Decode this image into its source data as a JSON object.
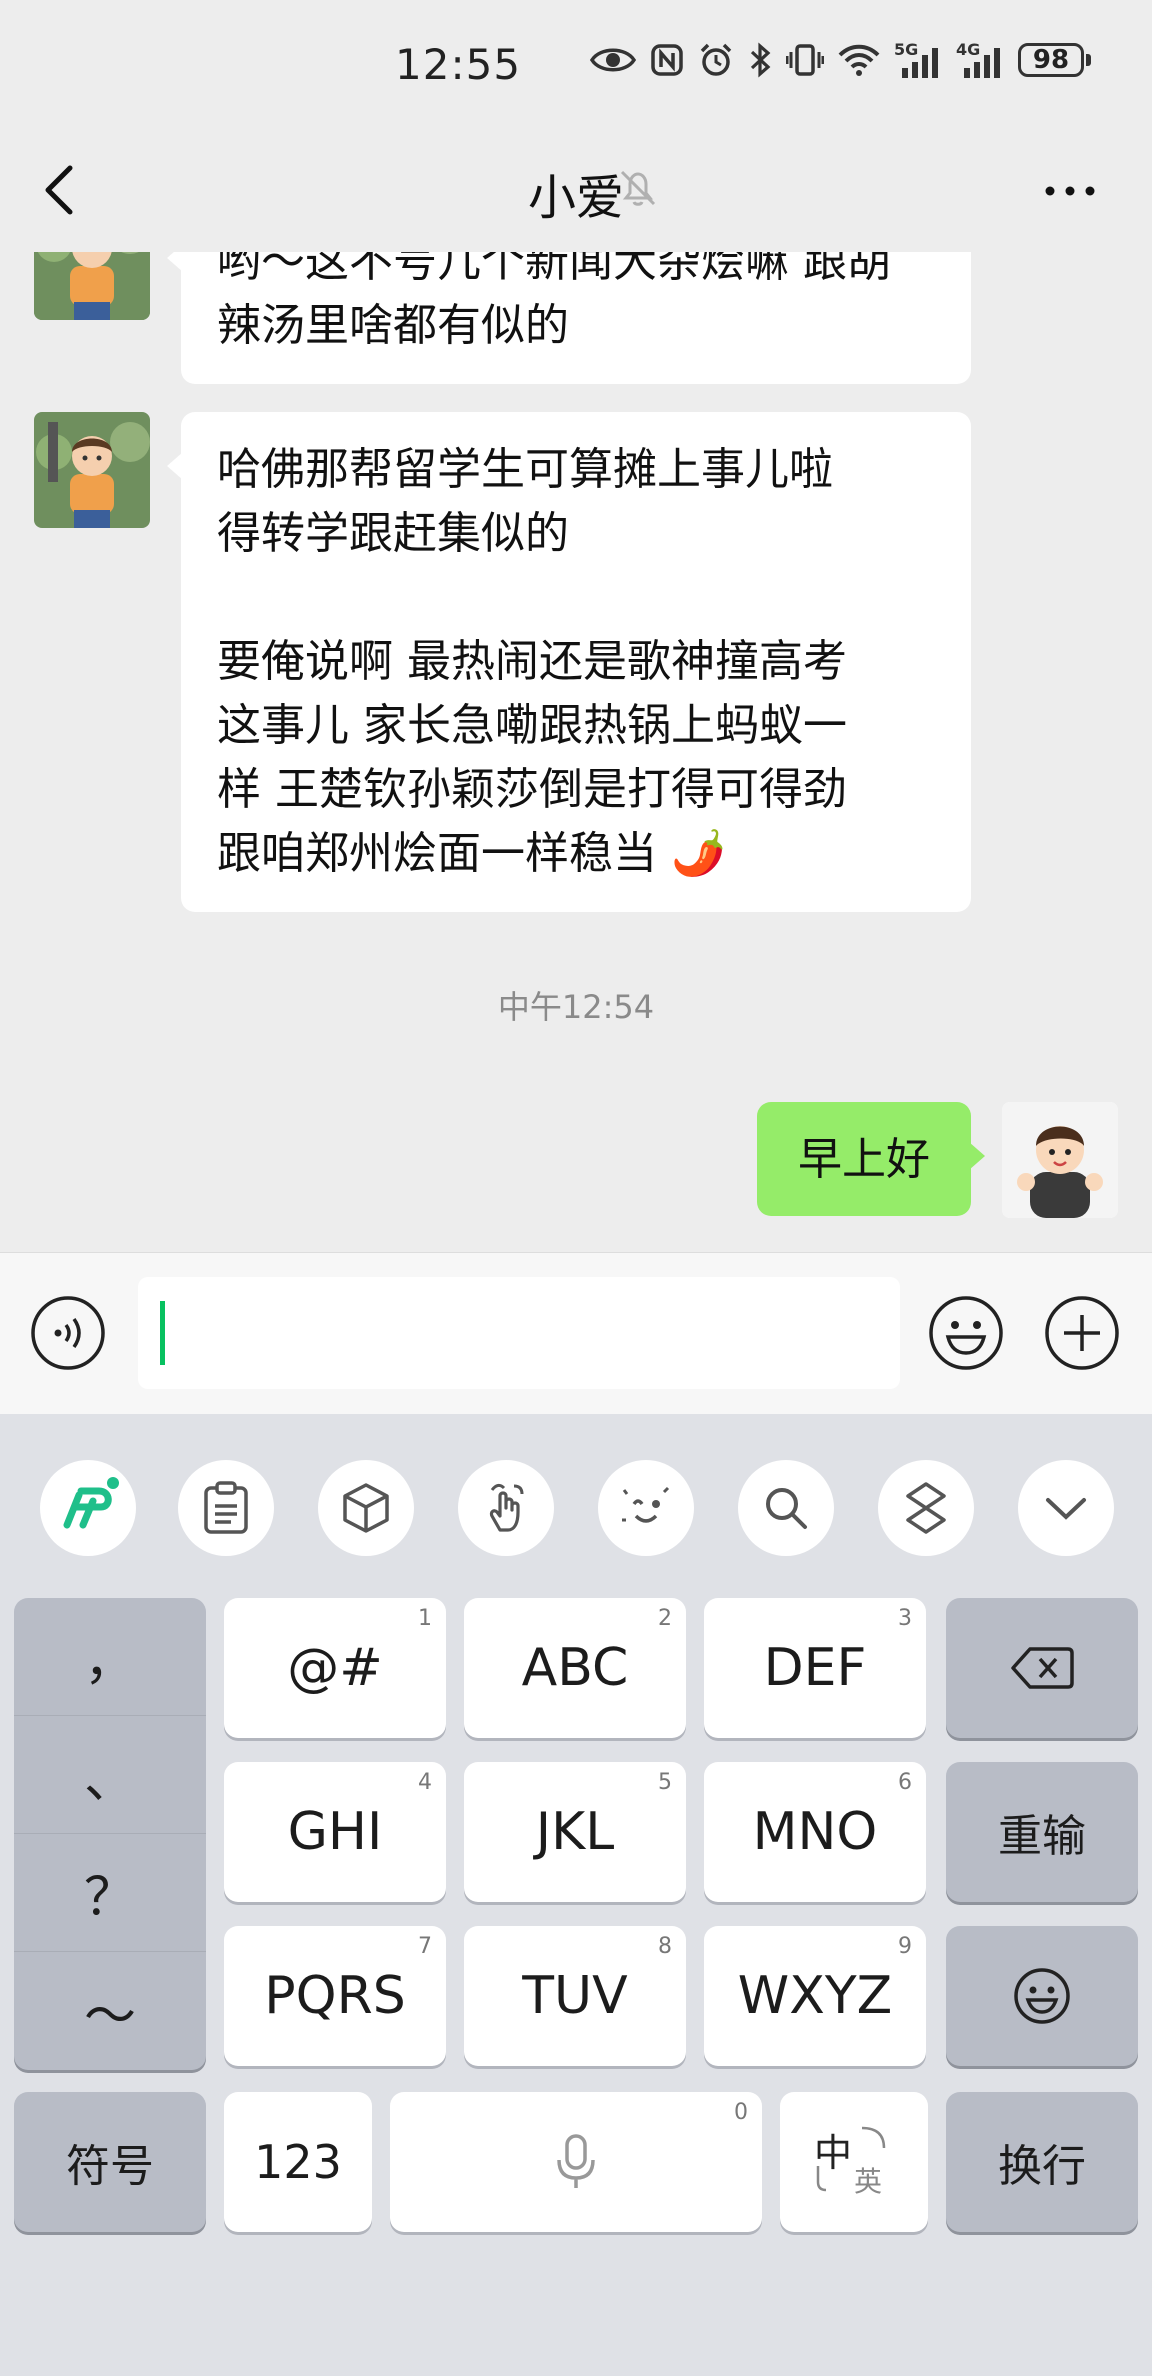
{
  "status_bar": {
    "time": "12:55",
    "battery": "98",
    "net1": "5G",
    "net2": "4G"
  },
  "header": {
    "title": "小爱"
  },
  "messages": [
    {
      "side": "in",
      "text": "哟～这不号几个新闻大杂烩嘛 跟胡\n辣汤里啥都有似的"
    },
    {
      "side": "in",
      "text": "哈佛那帮留学生可算摊上事儿啦\n得转学跟赶集似的\n\n要俺说啊 最热闹还是歌神撞高考\n这事儿 家长急嘞跟热锅上蚂蚁一\n样 王楚钦孙颖莎倒是打得可得劲\n跟咱郑州烩面一样稳当 🌶️"
    },
    {
      "side": "out",
      "text": "早上好"
    }
  ],
  "timestamp": "中午12:54",
  "keyboard": {
    "punctuation": [
      "，",
      "、",
      "？",
      "～"
    ],
    "rows": [
      [
        {
          "label": "@#",
          "num": "1"
        },
        {
          "label": "ABC",
          "num": "2"
        },
        {
          "label": "DEF",
          "num": "3"
        }
      ],
      [
        {
          "label": "GHI",
          "num": "4"
        },
        {
          "label": "JKL",
          "num": "5"
        },
        {
          "label": "MNO",
          "num": "6"
        }
      ],
      [
        {
          "label": "PQRS",
          "num": "7"
        },
        {
          "label": "TUV",
          "num": "8"
        },
        {
          "label": "WXYZ",
          "num": "9"
        }
      ]
    ],
    "reinput": "重输",
    "symbols": "符号",
    "numbers": "123",
    "space_num": "0",
    "lang_main": "中",
    "lang_sub": "英",
    "enter": "换行"
  }
}
